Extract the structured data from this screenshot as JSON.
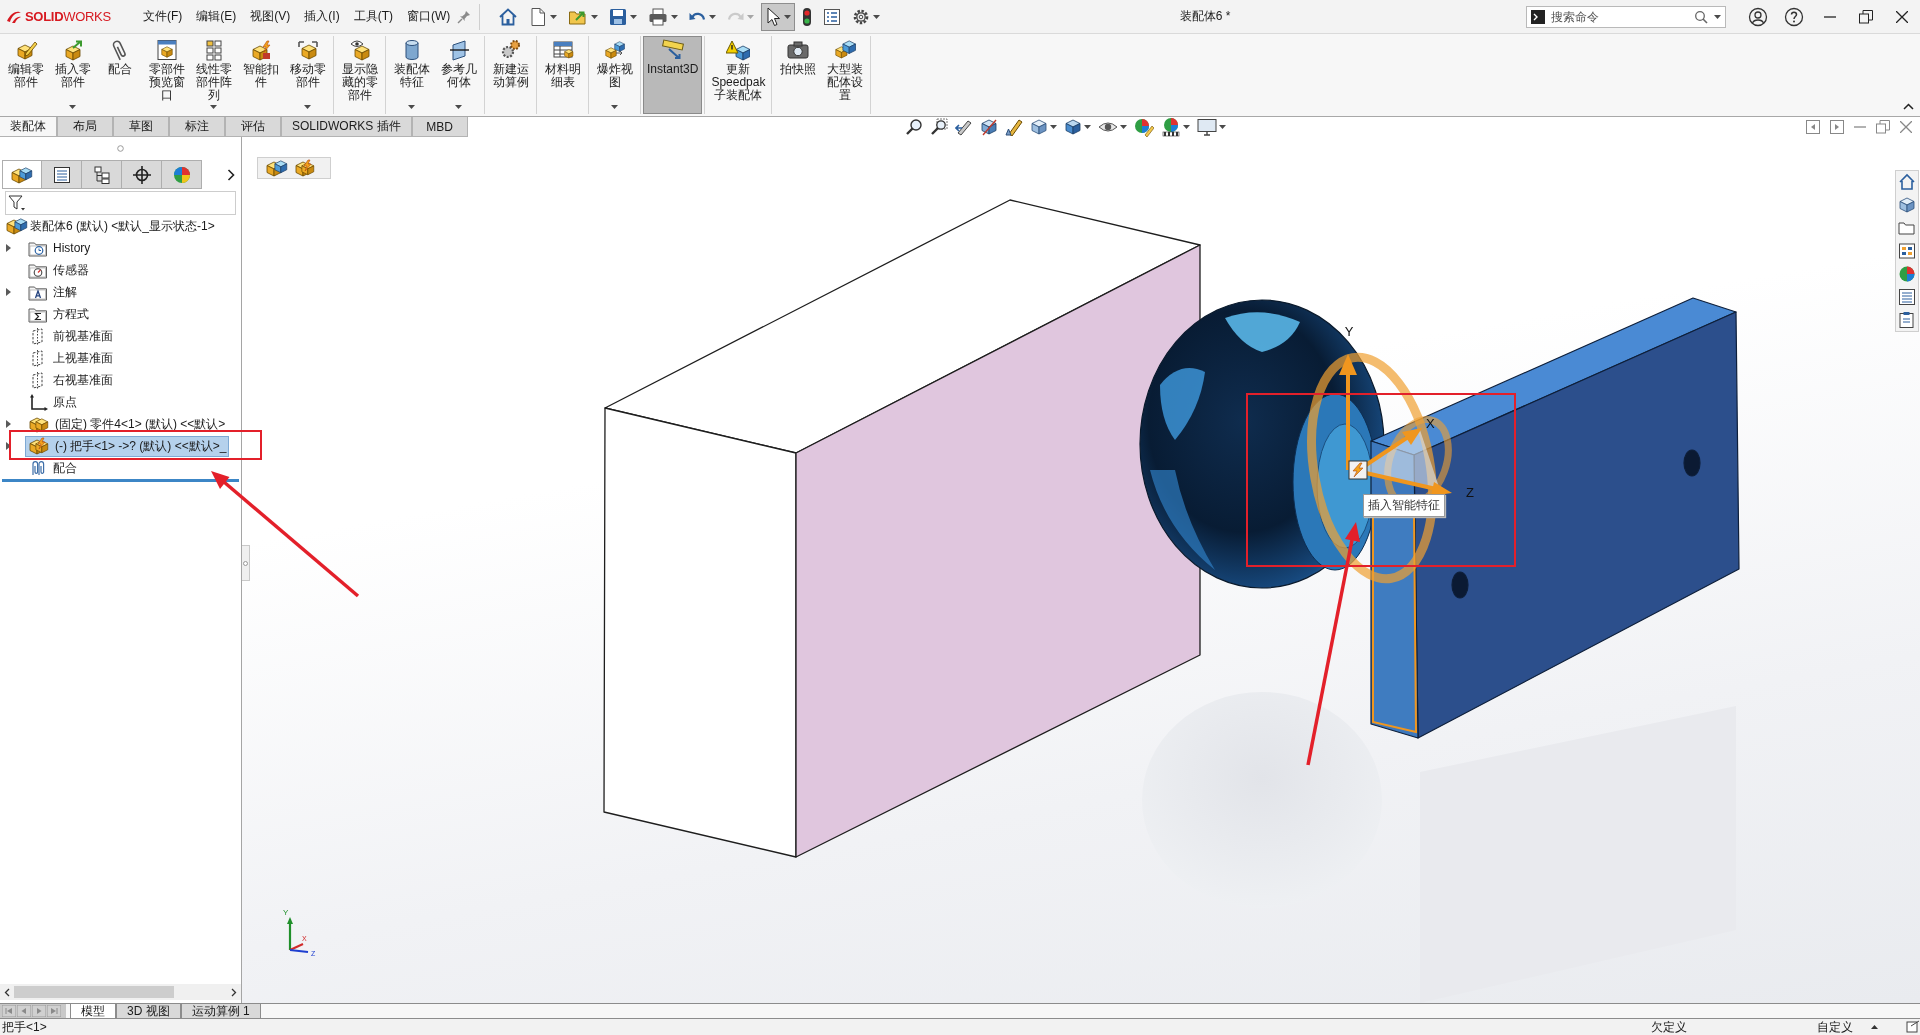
{
  "app": {
    "logo": "**SOLID**WORKS",
    "menus": [
      "文件(F)",
      "编辑(E)",
      "视图(V)",
      "插入(I)",
      "工具(T)",
      "窗口(W)"
    ],
    "document_title": "装配体6 *",
    "search": {
      "placeholder": "搜索命令"
    }
  },
  "quick_toolbar": [
    {
      "dropdown": false,
      "selected": false,
      "disabled": false
    },
    {
      "dropdown": true,
      "selected": false,
      "disabled": false
    },
    {
      "dropdown": true,
      "selected": false,
      "disabled": false
    },
    {
      "dropdown": true,
      "selected": false,
      "disabled": false
    },
    {
      "dropdown": true,
      "selected": false,
      "disabled": false
    },
    {
      "dropdown": true,
      "selected": false,
      "disabled": false
    },
    {
      "dropdown": true,
      "selected": false,
      "disabled": true
    },
    {
      "dropdown": true,
      "selected": true,
      "disabled": false
    },
    {
      "dropdown": false,
      "selected": false,
      "disabled": false
    },
    {
      "dropdown": false,
      "selected": false,
      "disabled": false
    },
    {
      "dropdown": true,
      "selected": false,
      "disabled": false
    }
  ],
  "ribbon": [
    {
      "buttons": [
        {
          "label": "编辑零部件",
          "dropdown": false,
          "selected": false
        },
        {
          "label": "插入零部件",
          "dropdown": true,
          "selected": false
        },
        {
          "label": "配合",
          "dropdown": false,
          "selected": false
        },
        {
          "label": "零部件预览窗口",
          "dropdown": false,
          "selected": false
        },
        {
          "label": "线性零部件阵列",
          "dropdown": true,
          "selected": false
        },
        {
          "label": "智能扣件",
          "dropdown": false,
          "selected": false
        },
        {
          "label": "移动零部件",
          "dropdown": true,
          "selected": false
        }
      ]
    },
    {
      "buttons": [
        {
          "label": "显示隐藏的零部件",
          "dropdown": false,
          "selected": false
        }
      ]
    },
    {
      "buttons": [
        {
          "label": "装配体特征",
          "dropdown": true,
          "selected": false
        },
        {
          "label": "参考几何体",
          "dropdown": true,
          "selected": false
        }
      ]
    },
    {
      "buttons": [
        {
          "label": "新建运动算例",
          "dropdown": false,
          "selected": false
        }
      ]
    },
    {
      "buttons": [
        {
          "label": "材料明细表",
          "dropdown": false,
          "selected": false
        }
      ]
    },
    {
      "buttons": [
        {
          "label": "爆炸视图",
          "dropdown": true,
          "selected": false
        }
      ]
    },
    {
      "buttons": [
        {
          "label": "Instant3D",
          "dropdown": false,
          "selected": true
        }
      ]
    },
    {
      "buttons": [
        {
          "label": "更新Speedpak子装配体",
          "dropdown": false,
          "selected": false
        }
      ]
    },
    {
      "buttons": [
        {
          "label": "拍快照",
          "dropdown": false,
          "selected": false
        },
        {
          "label": "大型装配体设置",
          "dropdown": false,
          "selected": false
        }
      ]
    }
  ],
  "command_tabs": [
    {
      "label": "装配体",
      "selected": true
    },
    {
      "label": "布局",
      "selected": false
    },
    {
      "label": "草图",
      "selected": false
    },
    {
      "label": "标注",
      "selected": false
    },
    {
      "label": "评估",
      "selected": false
    },
    {
      "label": "SOLIDWORKS 插件",
      "selected": false
    },
    {
      "label": "MBD",
      "selected": false
    }
  ],
  "view_toolbar": [
    {
      "dropdown": false
    },
    {
      "dropdown": false
    },
    {
      "dropdown": false
    },
    {
      "dropdown": false
    },
    {
      "dropdown": false
    },
    {
      "dropdown": true
    },
    {
      "dropdown": true
    },
    {
      "dropdown": true
    },
    {
      "dropdown": false
    },
    {
      "dropdown": true
    },
    {
      "dropdown": true
    }
  ],
  "feature_manager": {
    "tabs": [
      {
        "selected": true
      },
      {
        "selected": false
      },
      {
        "selected": false
      },
      {
        "selected": false
      },
      {
        "selected": false
      }
    ]
  },
  "tree": {
    "kind": "assembly",
    "label": "装配体6 (默认) <默认_显示状态-1>",
    "selected": false,
    "children": [
      {
        "kind": "history",
        "label": "History",
        "expandable": true,
        "selected": false
      },
      {
        "kind": "sensors",
        "label": "传感器",
        "expandable": false,
        "selected": false
      },
      {
        "kind": "annotations",
        "label": "注解",
        "expandable": true,
        "selected": false
      },
      {
        "kind": "equations",
        "label": "方程式",
        "expandable": false,
        "selected": false
      },
      {
        "kind": "plane",
        "label": "前视基准面",
        "expandable": false,
        "selected": false
      },
      {
        "kind": "plane",
        "label": "上视基准面",
        "expandable": false,
        "selected": false
      },
      {
        "kind": "plane",
        "label": "右视基准面",
        "expandable": false,
        "selected": false
      },
      {
        "kind": "origin",
        "label": "原点",
        "expandable": false,
        "selected": false
      },
      {
        "kind": "component",
        "label": "(固定) 零件4<1> (默认) <<默认>",
        "expandable": true,
        "selected": false
      },
      {
        "kind": "smart_component",
        "label": "(-) 把手<1> ->? (默认) <<默认>_",
        "expandable": true,
        "selected": true
      },
      {
        "kind": "mates",
        "label": "配合",
        "expandable": false,
        "selected": false
      }
    ]
  },
  "viewport": {
    "tooltip": "插入智能特征",
    "triad_labels": [
      "Y",
      "X",
      "Z"
    ],
    "orientation_labels": [
      "Y",
      "X",
      "Z"
    ]
  },
  "bottom_tabs": [
    {
      "label": "模型",
      "selected": true
    },
    {
      "label": "3D 视图",
      "selected": false
    },
    {
      "label": "运动算例 1",
      "selected": false
    }
  ],
  "status_bar": {
    "selection": "把手<1>",
    "constraint": "欠定义",
    "units": "自定义"
  }
}
